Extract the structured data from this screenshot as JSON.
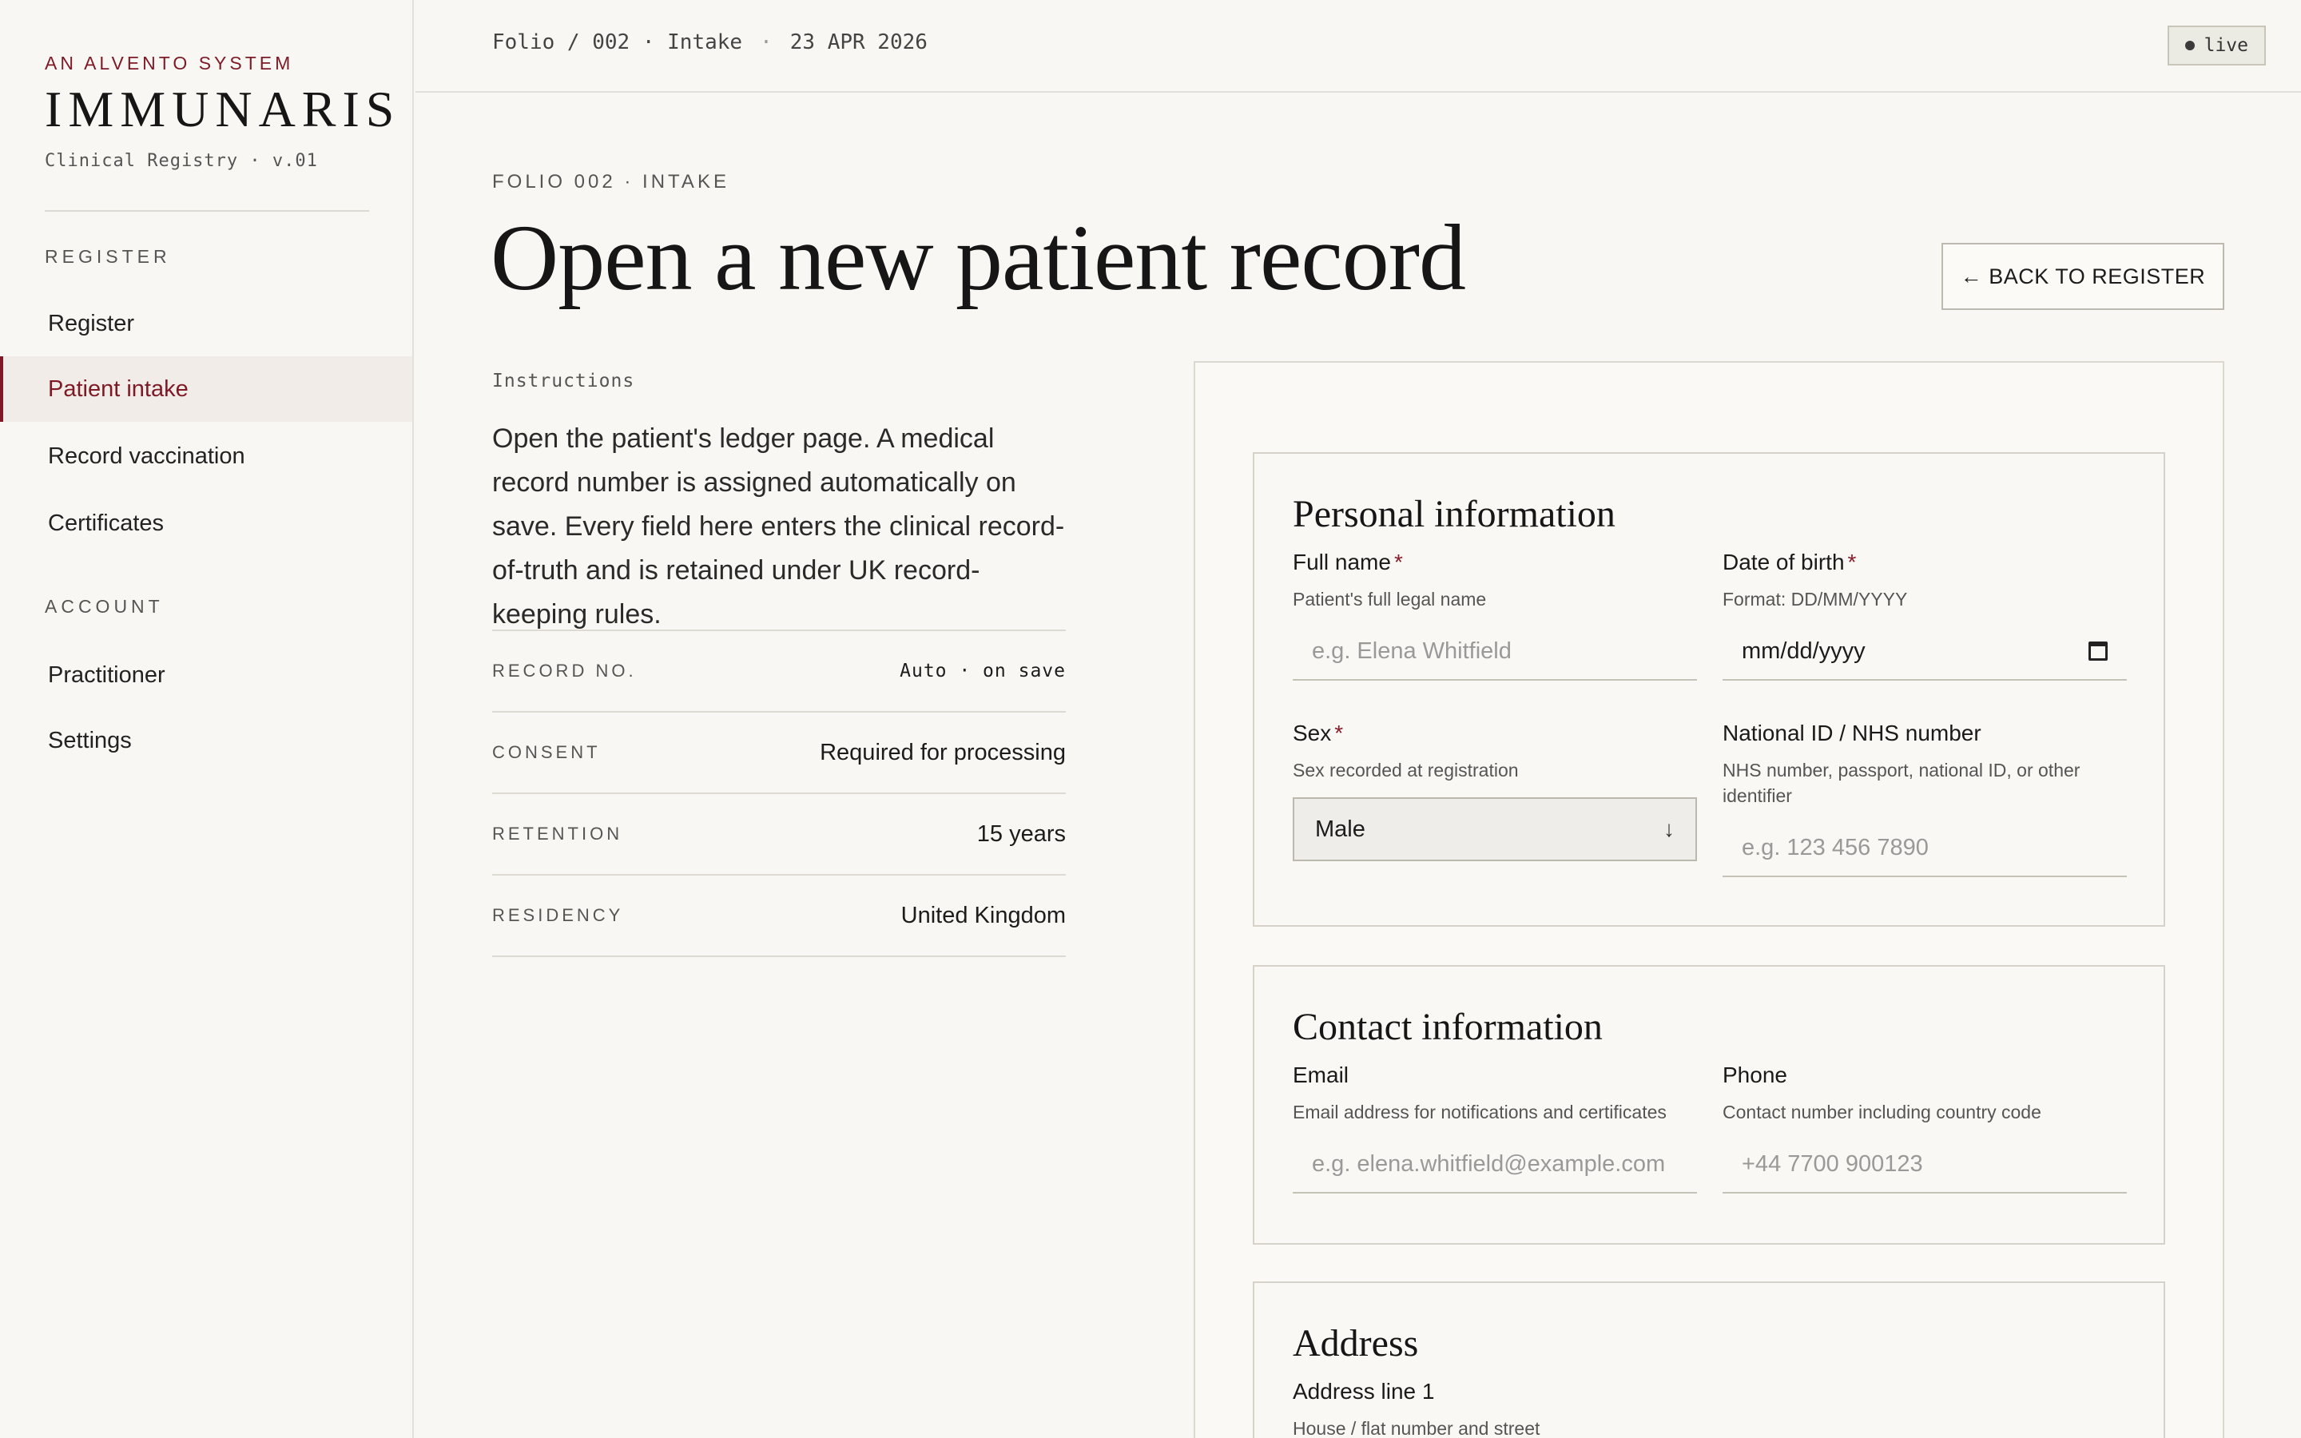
{
  "brand": {
    "kicker": "AN ALVENTO SYSTEM",
    "name": "IMMUNARIS",
    "subtitle": "Clinical Registry · v.01"
  },
  "nav": {
    "groups": [
      {
        "title": "REGISTER",
        "items": [
          {
            "label": "Register",
            "active": false
          },
          {
            "label": "Patient intake",
            "active": true
          },
          {
            "label": "Record vaccination",
            "active": false
          },
          {
            "label": "Certificates",
            "active": false
          }
        ]
      },
      {
        "title": "ACCOUNT",
        "items": [
          {
            "label": "Practitioner",
            "active": false
          },
          {
            "label": "Settings",
            "active": false
          }
        ]
      }
    ]
  },
  "topbar": {
    "breadcrumb": "Folio / 002 · Intake",
    "separator": "·",
    "date": "23 APR 2026",
    "status": "live"
  },
  "header": {
    "kicker": "FOLIO 002 · INTAKE",
    "title": "Open a new patient record",
    "back_button": "← BACK TO REGISTER"
  },
  "instructions": {
    "label": "Instructions",
    "text": "Open the patient's ledger page. A medical record number is assigned automatically on save. Every field here enters the clinical record-of-truth and is retained under UK record-keeping rules."
  },
  "info": [
    {
      "key": "RECORD NO.",
      "value": "Auto · on save"
    },
    {
      "key": "CONSENT",
      "value": "Required for processing"
    },
    {
      "key": "RETENTION",
      "value": "15 years"
    },
    {
      "key": "RESIDENCY",
      "value": "United Kingdom"
    }
  ],
  "form": {
    "personal": {
      "title": "Personal information",
      "full_name": {
        "label": "Full name",
        "required": "*",
        "help": "Patient's full legal name",
        "placeholder": "e.g. Elena Whitfield"
      },
      "dob": {
        "label": "Date of birth",
        "required": "*",
        "help": "Format: DD/MM/YYYY",
        "value": "mm/dd/yyyy"
      },
      "sex": {
        "label": "Sex",
        "required": "*",
        "help": "Sex recorded at registration",
        "value": "Male"
      },
      "national_id": {
        "label": "National ID / NHS number",
        "help": "NHS number, passport, national ID, or other identifier",
        "placeholder": "e.g. 123 456 7890"
      }
    },
    "contact": {
      "title": "Contact information",
      "email": {
        "label": "Email",
        "help": "Email address for notifications and certificates",
        "placeholder": "e.g. elena.whitfield@example.com"
      },
      "phone": {
        "label": "Phone",
        "help": "Contact number including country code",
        "placeholder": "+44 7700 900123"
      }
    },
    "address": {
      "title": "Address",
      "line1": {
        "label": "Address line 1",
        "help": "House / flat number and street"
      }
    }
  },
  "colors": {
    "accent": "#7d1a26",
    "background": "#f8f7f3"
  }
}
